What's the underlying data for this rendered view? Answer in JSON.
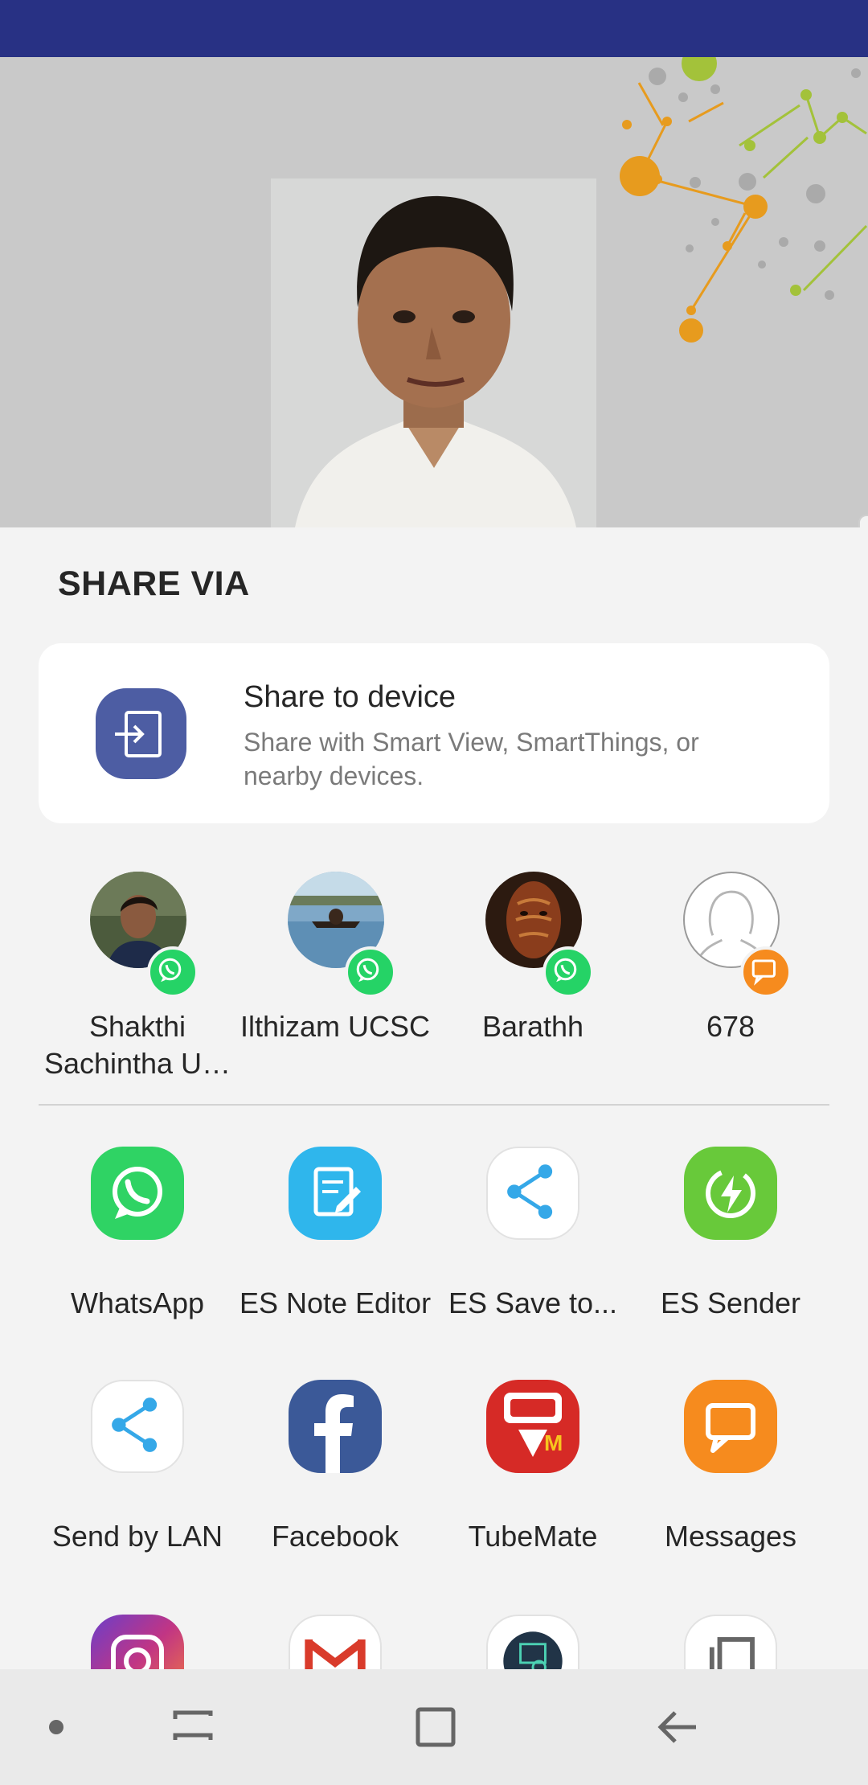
{
  "share_sheet": {
    "title": "SHARE VIA",
    "device_card": {
      "title": "Share to device",
      "subtitle": "Share with Smart View, SmartThings, or nearby devices.",
      "icon": "share-to-device-icon"
    },
    "direct_share": [
      {
        "name": "Shakthi Sachintha U…",
        "badge": "whatsapp-icon"
      },
      {
        "name": "Ilthizam UCSC",
        "badge": "whatsapp-icon"
      },
      {
        "name": "Barathh",
        "badge": "whatsapp-icon"
      },
      {
        "name": "678",
        "badge": "messages-icon"
      }
    ],
    "apps": [
      {
        "label": "WhatsApp",
        "icon": "whatsapp-icon"
      },
      {
        "label": "ES Note Editor",
        "icon": "es-note-editor-icon"
      },
      {
        "label": "ES Save to...",
        "icon": "es-save-icon"
      },
      {
        "label": "ES Sender",
        "icon": "es-sender-icon"
      },
      {
        "label": "Send by LAN",
        "icon": "send-by-lan-icon"
      },
      {
        "label": "Facebook",
        "icon": "facebook-icon"
      },
      {
        "label": "TubeMate",
        "icon": "tubemate-icon"
      },
      {
        "label": "Messages",
        "icon": "messages-icon"
      }
    ],
    "partial_apps": [
      "instagram-icon",
      "gmail-icon",
      "app-icon",
      "copy-icon"
    ]
  },
  "nav_bar": {
    "buttons": [
      "dot-icon",
      "recents-icon",
      "home-icon",
      "back-icon"
    ]
  },
  "colors": {
    "status_bar": "#283184",
    "whatsapp": "#25d366",
    "messages": "#f68b1e",
    "facebook": "#3b5998",
    "device_icon": "#4d5da3"
  }
}
